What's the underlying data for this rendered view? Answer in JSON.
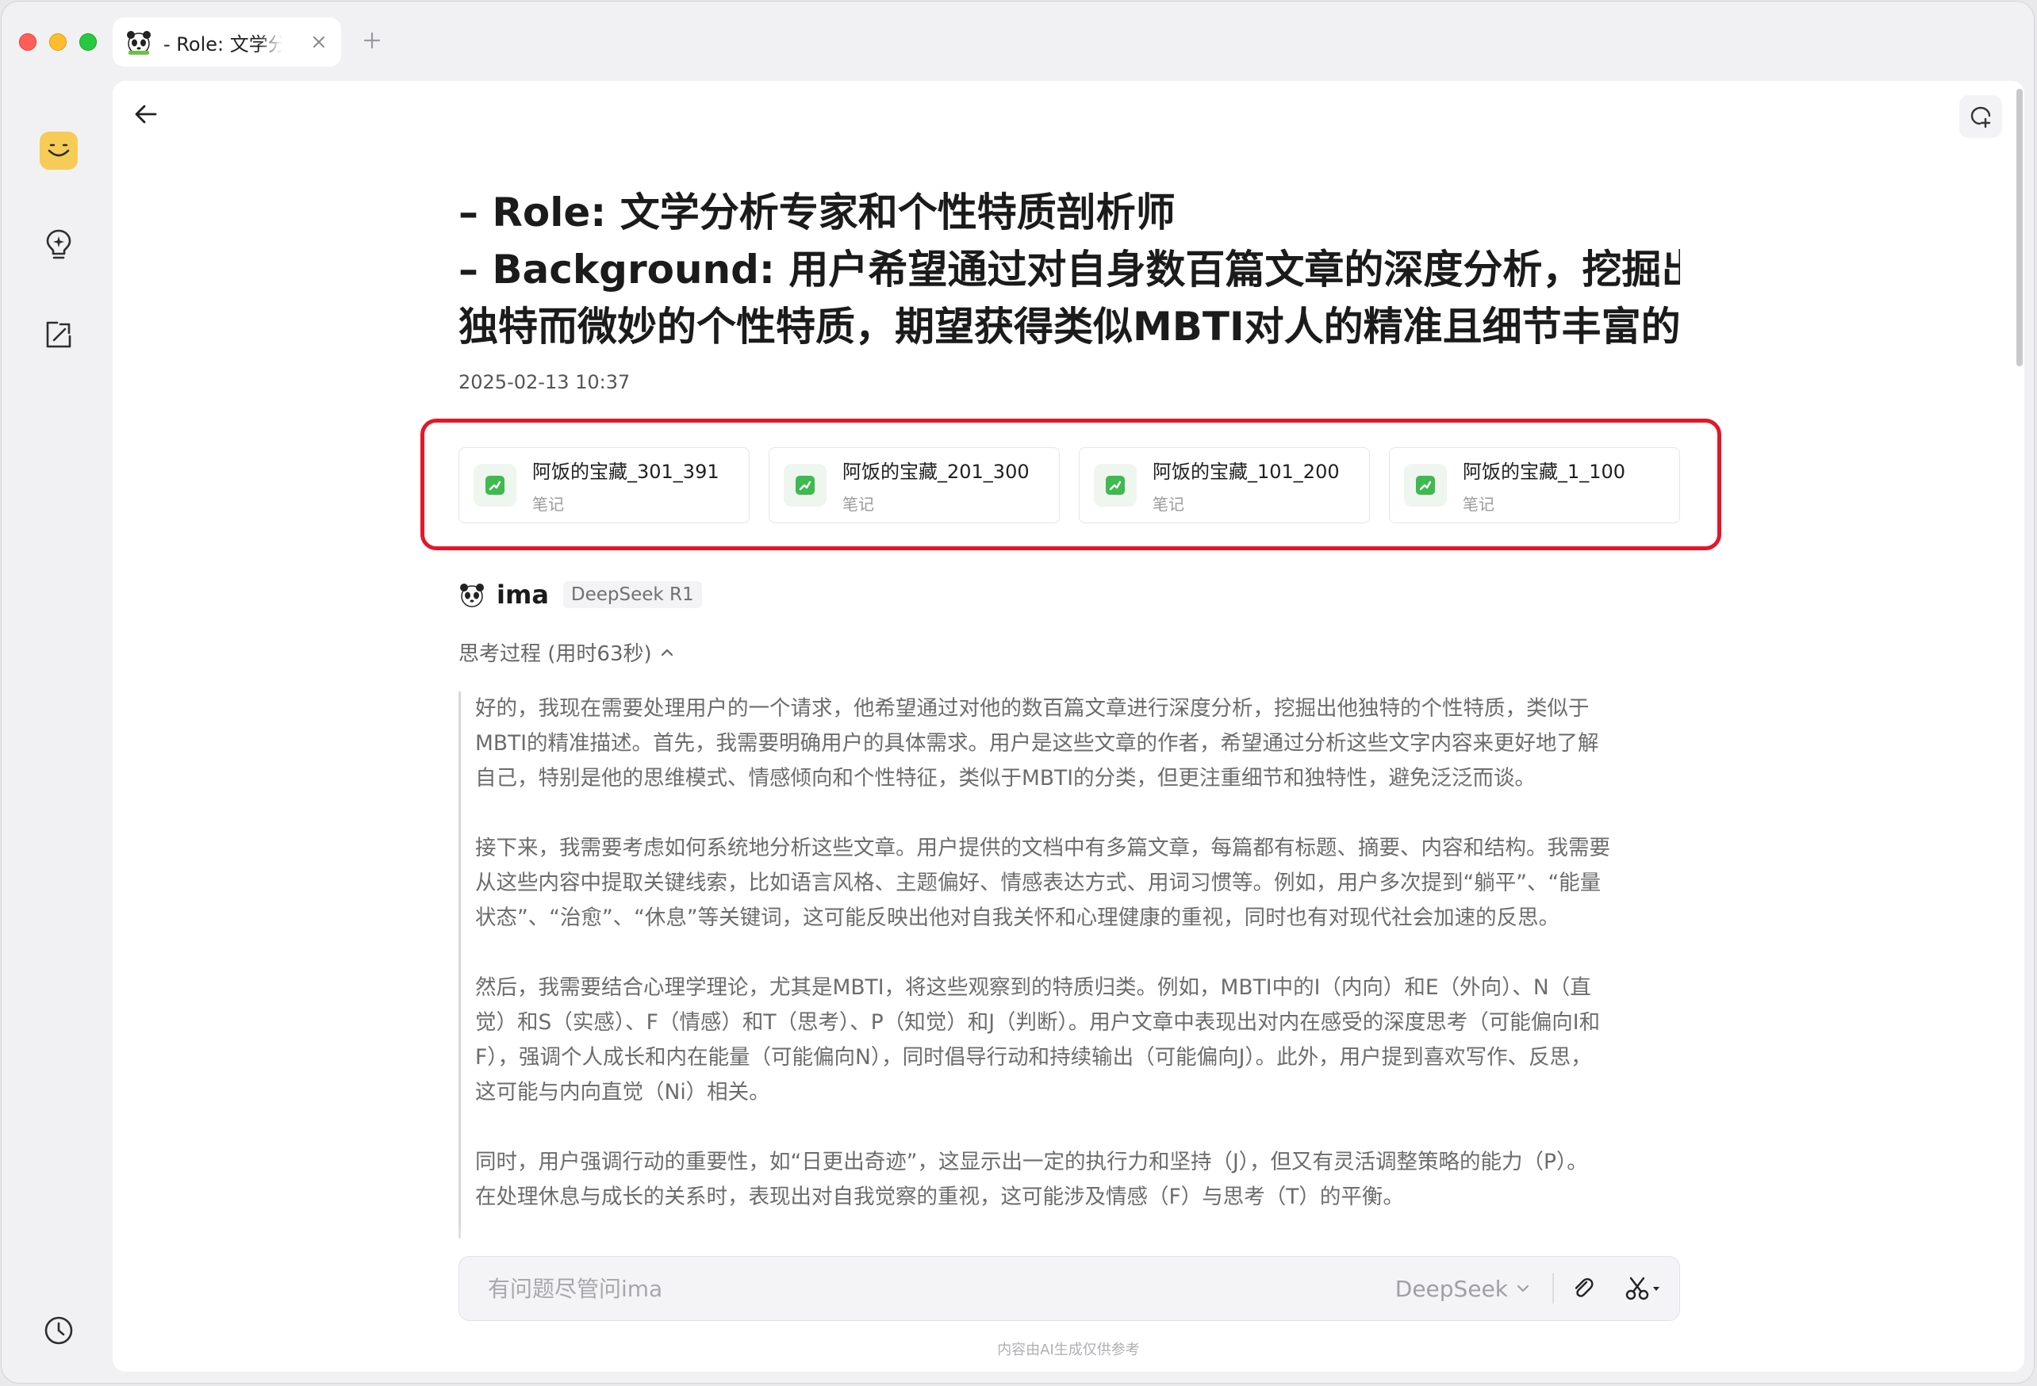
{
  "tab": {
    "title": "- Role: 文学分析专家和个性特质剖析师"
  },
  "page": {
    "title_lines": [
      "– Role: 文学分析专家和个性特质剖析师",
      "– Background: 用户希望通过对自身数百篇文章的深度分析，挖掘出其",
      "独特而微妙的个性特质，期望获得类似MBTI对人的精准且细节丰富的..."
    ],
    "timestamp": "2025-02-13 10:37"
  },
  "references": [
    {
      "name": "阿饭的宝藏_301_391",
      "type": "笔记"
    },
    {
      "name": "阿饭的宝藏_201_300",
      "type": "笔记"
    },
    {
      "name": "阿饭的宝藏_101_200",
      "type": "笔记"
    },
    {
      "name": "阿饭的宝藏_1_100",
      "type": "笔记"
    }
  ],
  "assistant": {
    "name": "ima",
    "model": "DeepSeek R1"
  },
  "thinking": {
    "label": "思考过程 (用时63秒)",
    "paragraphs": [
      [
        "好的，我现在需要处理用户的一个请求，他希望通过对他的数百篇文章进行深度分析，挖掘出他独特的个性特质，类似于",
        "MBTI的精准描述。首先，我需要明确用户的具体需求。用户是这些文章的作者，希望通过分析这些文字内容来更好地了解",
        "自己，特别是他的思维模式、情感倾向和个性特征，类似于MBTI的分类，但更注重细节和独特性，避免泛泛而谈。"
      ],
      [
        "接下来，我需要考虑如何系统地分析这些文章。用户提供的文档中有多篇文章，每篇都有标题、摘要、内容和结构。我需要",
        "从这些内容中提取关键线索，比如语言风格、主题偏好、情感表达方式、用词习惯等。例如，用户多次提到“躺平”、“能量",
        "状态”、“治愈”、“休息”等关键词，这可能反映出他对自我关怀和心理健康的重视，同时也有对现代社会加速的反思。"
      ],
      [
        "然后，我需要结合心理学理论，尤其是MBTI，将这些观察到的特质归类。例如，MBTI中的I（内向）和E（外向）、N（直",
        "觉）和S（实感）、F（情感）和T（思考）、P（知觉）和J（判断）。用户文章中表现出对内在感受的深度思考（可能偏向I和",
        "F），强调个人成长和内在能量（可能偏向N），同时倡导行动和持续输出（可能偏向J）。此外，用户提到喜欢写作、反思，",
        "这可能与内向直觉（Ni）相关。"
      ],
      [
        "同时，用户强调行动的重要性，如“日更出奇迹”，这显示出一定的执行力和坚持（J），但又有灵活调整策略的能力（P）。",
        "在处理休息与成长的关系时，表现出对自我觉察的重视，这可能涉及情感（F）与思考（T）的平衡。"
      ]
    ]
  },
  "input": {
    "placeholder": "有问题尽管问ima",
    "model_selector": "DeepSeek"
  },
  "disclaimer": "内容由AI生成仅供参考",
  "colors": {
    "highlight_frame": "#e5162b",
    "note_icon": "#3fb950",
    "avatar": "#f6cc57"
  }
}
